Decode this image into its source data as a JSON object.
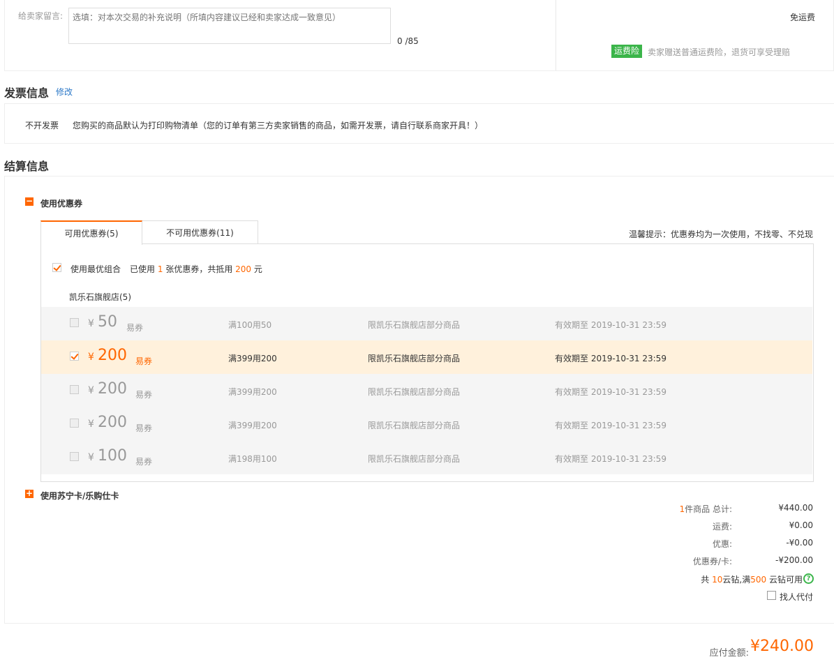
{
  "message": {
    "label": "给卖家留言:",
    "placeholder": "选填：对本次交易的补充说明（所填内容建议已经和卖家达成一致意见）",
    "count": "0 /85",
    "shipping": "免运费",
    "insurance_badge": "运费险",
    "insurance_text": "卖家赠送普通运费险，退货可享受理赔"
  },
  "invoice": {
    "title": "发票信息",
    "edit_label": "修改",
    "type": "不开发票",
    "note": "您购买的商品默认为打印购物清单（您的订单有第三方卖家销售的商品，如需开发票，请自行联系商家开具！）"
  },
  "settlement": {
    "title": "结算信息",
    "coupon_section": {
      "toggle": "−",
      "label": "使用优惠券",
      "tabs": [
        {
          "label": "可用优惠券(5)"
        },
        {
          "label": "不可用优惠券(11)"
        }
      ],
      "tip": "温馨提示：优惠券均为一次使用，不找零、不兑现",
      "best_combo": {
        "label": "使用最优组合",
        "used_prefix": "已使用",
        "used_count": "1",
        "used_mid": "张优惠券，共抵用",
        "used_amount": "200",
        "used_suffix": "元"
      },
      "store": "凯乐石旗舰店(5)",
      "coupons": [
        {
          "yen": "¥",
          "amount": "50",
          "type": "易券",
          "condition": "满100用50",
          "scope": "限凯乐石旗舰店部分商品",
          "validity": "有效期至 2019-10-31 23:59",
          "checked": false
        },
        {
          "yen": "¥",
          "amount": "200",
          "type": "易券",
          "condition": "满399用200",
          "scope": "限凯乐石旗舰店部分商品",
          "validity": "有效期至 2019-10-31 23:59",
          "checked": true
        },
        {
          "yen": "¥",
          "amount": "200",
          "type": "易券",
          "condition": "满399用200",
          "scope": "限凯乐石旗舰店部分商品",
          "validity": "有效期至 2019-10-31 23:59",
          "checked": false
        },
        {
          "yen": "¥",
          "amount": "200",
          "type": "易券",
          "condition": "满399用200",
          "scope": "限凯乐石旗舰店部分商品",
          "validity": "有效期至 2019-10-31 23:59",
          "checked": false
        },
        {
          "yen": "¥",
          "amount": "100",
          "type": "易券",
          "condition": "满198用100",
          "scope": "限凯乐石旗舰店部分商品",
          "validity": "有效期至 2019-10-31 23:59",
          "checked": false
        }
      ]
    },
    "card_section": {
      "toggle": "+",
      "label": "使用苏宁卡/乐购仕卡"
    },
    "summary": {
      "items_count": "1",
      "items_label": "件商品 总计:",
      "items_total": "¥440.00",
      "shipping_label": "运费:",
      "shipping_value": "¥0.00",
      "discount_label": "优惠:",
      "discount_value": "-¥0.00",
      "coupon_label": "优惠券/卡:",
      "coupon_value": "-¥200.00",
      "diamond_prefix": "共",
      "diamond_count": "10",
      "diamond_mid": "云钻,满",
      "diamond_threshold": "500",
      "diamond_suffix": "云钻可用",
      "help": "?",
      "proxy_label": "找人代付"
    },
    "payable_label": "应付金额:",
    "payable_value": "¥240.00"
  },
  "colors": {
    "accent": "#ff6600",
    "link": "#2d79c8",
    "green": "#3bb54a",
    "selected_row": "#fff1dc"
  }
}
